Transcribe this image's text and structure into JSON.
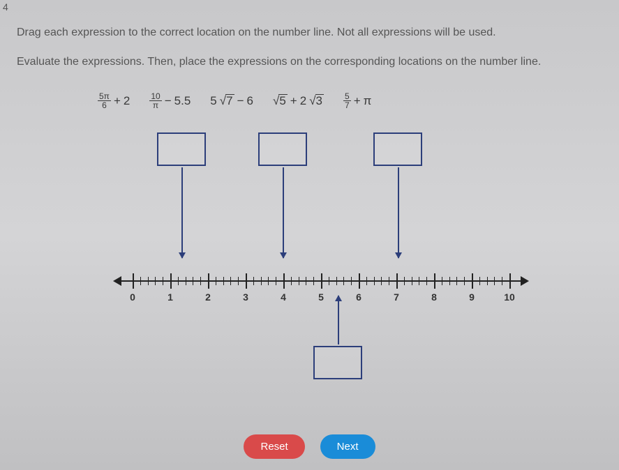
{
  "question_number": "4",
  "instruction1": "Drag each expression to the correct location on the number line. Not all expressions will be used.",
  "instruction2": "Evaluate the expressions. Then, place the expressions on the corresponding locations on the number line.",
  "expressions": {
    "e1": {
      "frac_num": "5π",
      "frac_den": "6",
      "plus": "+",
      "val": "2"
    },
    "e2": {
      "frac_num": "10",
      "frac_den": "π",
      "minus": "−",
      "val": "5.5"
    },
    "e3": {
      "five": "5",
      "seven": "7",
      "minus": "−",
      "six": "6"
    },
    "e4": {
      "five": "5",
      "plus": "+",
      "two": "2",
      "three": "3"
    },
    "e5": {
      "frac_num": "5",
      "frac_den": "7",
      "plus": "+",
      "pi": "π"
    }
  },
  "axis_labels": [
    "0",
    "1",
    "2",
    "3",
    "4",
    "5",
    "6",
    "7",
    "8",
    "9",
    "10"
  ],
  "buttons": {
    "reset": "Reset",
    "next": "Next"
  }
}
